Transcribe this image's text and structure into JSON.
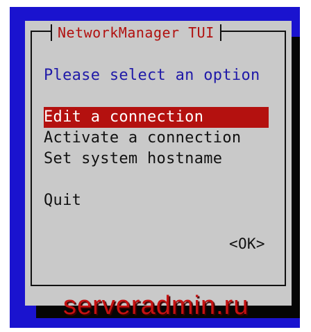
{
  "dialog": {
    "title": "NetworkManager TUI",
    "prompt": "Please select an option",
    "items": [
      {
        "label": "Edit a connection",
        "selected": true
      },
      {
        "label": "Activate a connection",
        "selected": false
      },
      {
        "label": "Set system hostname",
        "selected": false
      }
    ],
    "quit_label": "Quit",
    "ok_label": "<OK>"
  },
  "watermark": "serveradmin.ru",
  "colors": {
    "background": "#1a13cf",
    "dialog": "#c9c9c9",
    "title": "#b1100f",
    "selected": "#b4110f",
    "prompt": "#201aa8"
  }
}
